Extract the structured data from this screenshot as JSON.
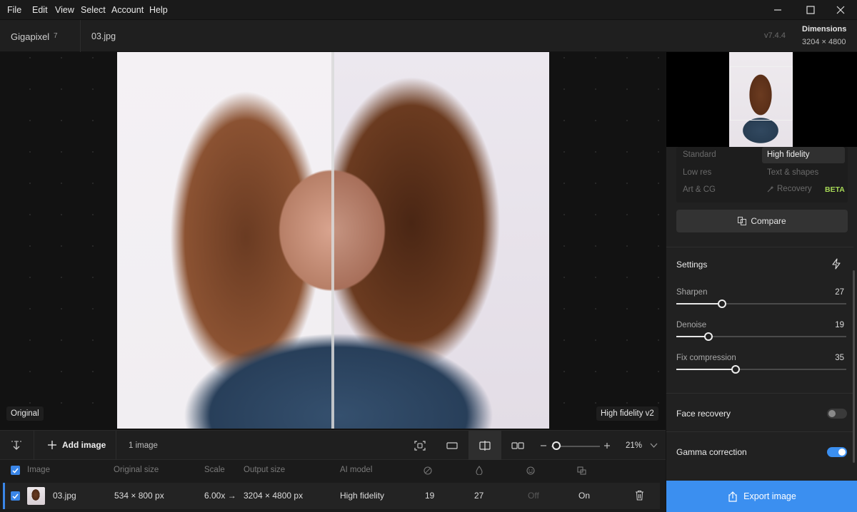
{
  "menu": [
    "File",
    "Edit",
    "View",
    "Select",
    "Account",
    "Help"
  ],
  "app": {
    "name": "Gigapixel",
    "major": "7",
    "version": "v7.4.4"
  },
  "file_tab": "03.jpg",
  "dimensions": {
    "label": "Dimensions",
    "value": "3204 × 4800"
  },
  "canvas": {
    "label_left": "Original",
    "label_right": "High fidelity v2"
  },
  "toolbar": {
    "add_image": "Add image",
    "image_count": "1 image",
    "zoom": "21%",
    "zoom_level": 0.1
  },
  "filelist": {
    "headers": [
      "Image",
      "Original size",
      "Scale",
      "Output size",
      "AI model"
    ],
    "row": {
      "name": "03.jpg",
      "original_size": "534 × 800 px",
      "scale": "6.00x →",
      "output_size": "3204 × 4800 px",
      "model": "High fidelity",
      "val1": "19",
      "val2": "27",
      "face": "Off",
      "gamma": "On"
    }
  },
  "models": {
    "standard": "Standard",
    "high_fidelity": "High fidelity",
    "low_res": "Low res",
    "text_shapes": "Text & shapes",
    "art_cg": "Art & CG",
    "recovery": "Recovery",
    "beta": "BETA"
  },
  "compare_label": "Compare",
  "settings": {
    "title": "Settings",
    "sliders": [
      {
        "label": "Sharpen",
        "value": "27",
        "fraction": 0.27
      },
      {
        "label": "Denoise",
        "value": "19",
        "fraction": 0.19
      },
      {
        "label": "Fix compression",
        "value": "35",
        "fraction": 0.35
      }
    ],
    "face_recovery": {
      "label": "Face recovery",
      "on": false
    },
    "gamma_correction": {
      "label": "Gamma correction",
      "on": true
    }
  },
  "export_label": "Export image",
  "colors": {
    "accent": "#3b8ff0",
    "beta": "#a6d856"
  }
}
